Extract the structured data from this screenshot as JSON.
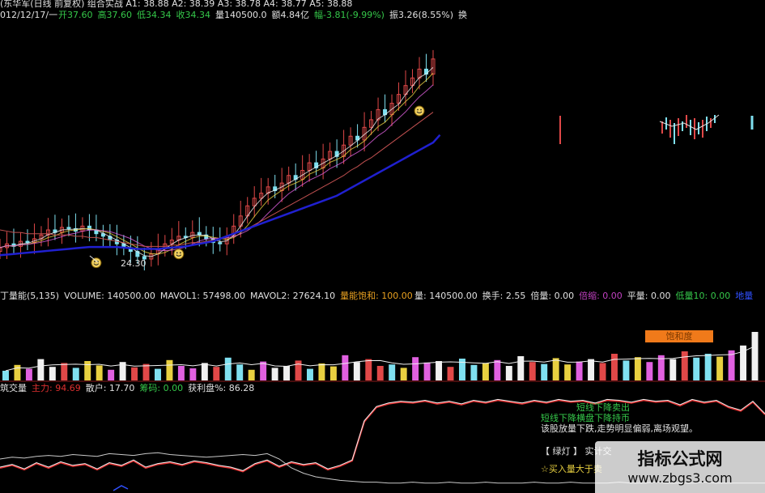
{
  "price_header": {
    "line1": "(东华军(日线 前复权) 组合实战  A1: 38.88  A2: 38.39  A3: 38.78  A4: 38.77  A5: 38.88",
    "date": "012/12/17/一",
    "items": [
      {
        "text": "开37.60",
        "color": "#35c84a"
      },
      {
        "text": "高37.60",
        "color": "#35c84a"
      },
      {
        "text": "低34.34",
        "color": "#35c84a"
      },
      {
        "text": "收34.34",
        "color": "#35c84a"
      },
      {
        "text": "量140500.0",
        "color": "#e0e0e0"
      },
      {
        "text": "额4.84亿",
        "color": "#e0e0e0"
      },
      {
        "text": "幅-3.81(-9.99%)",
        "color": "#35c84a"
      },
      {
        "text": "振3.26(8.55%)",
        "color": "#e0e0e0"
      },
      {
        "text": "换",
        "color": "#e0e0e0"
      }
    ]
  },
  "price_panel": {
    "low_label": "24.30"
  },
  "volume_header": {
    "left": [
      {
        "text": "丁量能(5,135)",
        "color": "#e0e0e0"
      },
      {
        "text": "VOLUME: 140500.00",
        "color": "#e0e0e0"
      },
      {
        "text": "MAVOL1: 57498.00",
        "color": "#e0e0e0"
      },
      {
        "text": "MAVOL2: 27624.10",
        "color": "#e0e0e0"
      },
      {
        "text": "量能饱和: 100.00",
        "color": "#e8a020"
      }
    ],
    "right": [
      {
        "text": "量: 140500.00",
        "color": "#e0e0e0"
      },
      {
        "text": "换手: 2.55",
        "color": "#e0e0e0"
      },
      {
        "text": "倍量: 0.00",
        "color": "#e0e0e0"
      },
      {
        "text": "倍缩: 0.00",
        "color": "#c040c0"
      },
      {
        "text": "平量: 0.00",
        "color": "#e0e0e0"
      },
      {
        "text": "低量10: 0.00",
        "color": "#35c84a"
      },
      {
        "text": "地量",
        "color": "#3050ff"
      }
    ]
  },
  "volume_badge": "饱和度",
  "indicator_header": [
    {
      "text": "筑交量",
      "color": "#e0e0e0"
    },
    {
      "text": "主力: 94.69",
      "color": "#e03030"
    },
    {
      "text": "散户: 17.70",
      "color": "#e0e0e0"
    },
    {
      "text": "筹码: 0.00",
      "color": "#35c84a"
    },
    {
      "text": "获利盘%: 86.28",
      "color": "#e0e0e0"
    }
  ],
  "signal_texts": [
    {
      "text": "短线下降卖出",
      "color": "#35c84a"
    },
    {
      "text": "短线下降横盘下降持币",
      "color": "#35c84a"
    },
    {
      "text": "该股放量下跌,走势明显偏弱,离场观望。",
      "color": "#e0e0e0"
    }
  ],
  "bottom_texts": [
    {
      "text": "【 绿灯 】 实计交",
      "color": "#e0e0e0"
    },
    {
      "text": "☆买入量大于卖",
      "color": "#e8d040"
    }
  ],
  "watermark": {
    "title": "指标公式网",
    "url": "www.zbgs3.com"
  },
  "colors": {
    "up": "#e04848",
    "down": "#7fe0f0",
    "ma_long": "#2020d0",
    "badge": "#f07a1a"
  },
  "chart_data": [
    {
      "type": "line",
      "name": "price",
      "x": [
        1,
        2,
        3,
        4,
        5,
        6,
        7,
        8,
        9,
        10,
        11,
        12,
        13,
        14,
        15,
        16,
        17,
        18,
        19,
        20,
        21,
        22,
        23,
        24,
        25,
        26,
        27,
        28,
        29,
        30,
        31,
        32,
        33,
        34,
        35,
        36,
        37,
        38,
        39,
        40,
        41,
        42,
        43,
        44,
        45,
        46,
        47,
        48,
        49,
        50,
        51,
        52,
        53,
        54,
        55,
        56,
        57,
        58,
        59,
        60,
        61,
        62,
        63,
        64
      ],
      "series": [
        {
          "values": [
            25.5,
            25.8,
            25.6,
            26.0,
            25.9,
            26.2,
            26.5,
            26.9,
            26.7,
            27.1,
            27.0,
            26.8,
            27.2,
            26.9,
            26.6,
            26.4,
            26.1,
            25.8,
            25.5,
            25.2,
            24.8,
            24.6,
            25.0,
            25.4,
            25.8,
            26.1,
            26.4,
            26.3,
            26.7,
            26.5,
            26.2,
            25.9,
            25.8,
            26.4,
            27.2,
            28.0,
            28.8,
            29.4,
            29.8,
            30.3,
            30.0,
            30.6,
            31.2,
            30.9,
            31.6,
            32.2,
            31.8,
            32.5,
            33.1,
            32.7,
            33.6,
            34.3,
            34.0,
            35.0,
            35.6,
            36.4,
            36.0,
            36.9,
            37.6,
            38.3,
            38.9,
            39.6,
            39.2,
            40.4
          ]
        },
        {
          "values": [
            26.9,
            26.8,
            26.7,
            26.7,
            26.6,
            26.6,
            26.6,
            26.6,
            26.5,
            26.5,
            26.5,
            26.4,
            26.4,
            26.3,
            26.3,
            26.2,
            26.1,
            26.0,
            25.9,
            25.8,
            25.7,
            25.6,
            25.6,
            25.6,
            25.6,
            25.7,
            25.7,
            25.8,
            25.9,
            25.9,
            26.0,
            26.1,
            26.2,
            26.4,
            26.6,
            26.8,
            27.0,
            27.3,
            27.6,
            27.9,
            28.2,
            28.5,
            28.8,
            29.1,
            29.4,
            29.7,
            30.0,
            30.3,
            30.6,
            30.9,
            31.2,
            31.6,
            31.9,
            32.3,
            32.6,
            33.0,
            33.4,
            33.8,
            34.2,
            34.6,
            35.0,
            35.4,
            35.8,
            36.2
          ]
        },
        {
          "values": [
            24.9,
            24.95,
            25.0,
            25.05,
            25.1,
            25.15,
            25.2,
            25.25,
            25.3,
            25.35,
            25.4,
            25.45,
            25.5,
            25.55,
            25.55,
            25.55,
            25.55,
            25.55,
            25.5,
            25.45,
            25.4,
            25.4,
            25.4,
            25.4,
            25.45,
            25.5,
            25.55,
            25.6,
            25.7,
            25.8,
            25.9,
            26.0,
            26.2,
            26.4,
            26.6,
            26.8,
            27.0,
            27.2,
            27.4,
            27.6,
            27.8,
            28.0,
            28.2,
            28.4,
            28.6,
            28.8,
            29.0,
            29.2,
            29.4,
            29.6,
            29.9,
            30.2,
            30.5,
            30.8,
            31.1,
            31.4,
            31.7,
            32.0,
            32.3,
            32.6,
            32.9,
            33.2,
            33.5,
            33.8
          ]
        }
      ],
      "ylim": [
        23.0,
        42.5
      ]
    },
    {
      "type": "bar",
      "name": "volume",
      "values": [
        20,
        32,
        24,
        44,
        28,
        36,
        26,
        40,
        31,
        22,
        38,
        27,
        34,
        24,
        42,
        30,
        25,
        36,
        28,
        47,
        33,
        22,
        39,
        26,
        30,
        41,
        24,
        35,
        29,
        52,
        38,
        44,
        30,
        33,
        26,
        48,
        37,
        40,
        28,
        45,
        32,
        36,
        42,
        30,
        50,
        38,
        34,
        46,
        33,
        39,
        44,
        36,
        55,
        41,
        48,
        38,
        52,
        44,
        60,
        47,
        55,
        49,
        62,
        72,
        100
      ],
      "ylim": [
        0,
        100
      ]
    },
    {
      "type": "line",
      "name": "indicator",
      "series": [
        {
          "values": [
            20,
            23,
            18,
            25,
            20,
            26,
            22,
            24,
            18,
            25,
            22,
            28,
            20,
            24,
            26,
            23,
            27,
            25,
            22,
            20,
            16,
            24,
            28,
            21,
            26,
            23,
            25,
            18,
            22,
            28,
            72,
            88,
            92,
            94,
            93,
            95,
            92,
            94,
            91,
            95,
            93,
            96,
            94,
            92,
            95,
            93,
            96,
            94,
            95,
            92,
            96,
            95,
            93,
            96,
            94,
            95,
            90,
            96,
            93,
            95,
            88,
            84,
            94,
            80
          ]
        },
        {
          "values": [
            30,
            32,
            31,
            33,
            34,
            33,
            35,
            34,
            33,
            36,
            35,
            34,
            36,
            37,
            35,
            34,
            33,
            32,
            33,
            34,
            35,
            34,
            36,
            30,
            20,
            14,
            10,
            8,
            6,
            5,
            4,
            4,
            3,
            3,
            4,
            3,
            3,
            4,
            3,
            3,
            4,
            3,
            3,
            3,
            4,
            3,
            3,
            4,
            3,
            3,
            3,
            4,
            3,
            3,
            4,
            3,
            3,
            3,
            4,
            3,
            3,
            3,
            3,
            3
          ]
        }
      ],
      "ylim": [
        0,
        100
      ]
    }
  ]
}
